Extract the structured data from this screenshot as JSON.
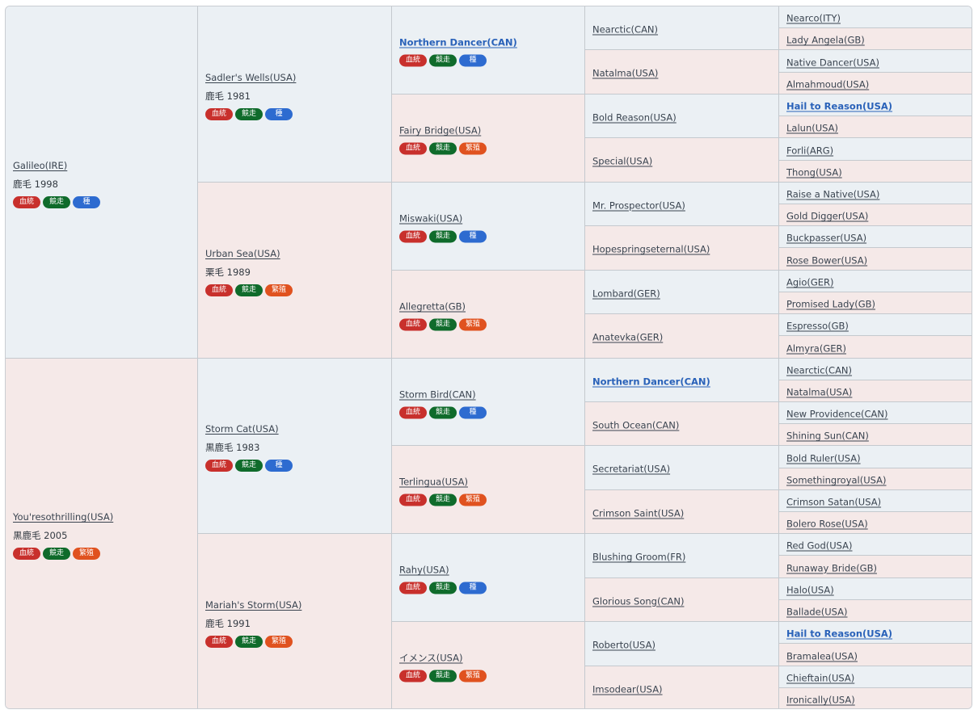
{
  "badge_labels": {
    "blood": "血統",
    "race": "競走",
    "sire": "種",
    "breed": "繁殖"
  },
  "colors": {
    "male_bg": "#ebf0f4",
    "female_bg": "#f5e9e8",
    "link_bold": "#2a62b9",
    "badge_blood": "#c8302c",
    "badge_race": "#0f6b2b",
    "badge_sire": "#2d6bd0",
    "badge_breed": "#e0521f"
  },
  "pedigree": {
    "gen1": [
      {
        "name": "Galileo(IRE)",
        "info": "鹿毛 1998",
        "badges": [
          "blood",
          "race",
          "sire"
        ]
      },
      {
        "name": "You'resothrilling(USA)",
        "info": "黒鹿毛 2005",
        "badges": [
          "blood",
          "race",
          "breed"
        ]
      }
    ],
    "gen2": [
      {
        "name": "Sadler's Wells(USA)",
        "info": "鹿毛 1981",
        "badges": [
          "blood",
          "race",
          "sire"
        ]
      },
      {
        "name": "Urban Sea(USA)",
        "info": "栗毛 1989",
        "badges": [
          "blood",
          "race",
          "breed"
        ]
      },
      {
        "name": "Storm Cat(USA)",
        "info": "黒鹿毛 1983",
        "badges": [
          "blood",
          "race",
          "sire"
        ]
      },
      {
        "name": "Mariah's Storm(USA)",
        "info": "鹿毛 1991",
        "badges": [
          "blood",
          "race",
          "breed"
        ]
      }
    ],
    "gen3": [
      {
        "name": "Northern Dancer(CAN)",
        "bold": true,
        "badges": [
          "blood",
          "race",
          "sire"
        ]
      },
      {
        "name": "Fairy Bridge(USA)",
        "badges": [
          "blood",
          "race",
          "breed"
        ]
      },
      {
        "name": "Miswaki(USA)",
        "badges": [
          "blood",
          "race",
          "sire"
        ]
      },
      {
        "name": "Allegretta(GB)",
        "badges": [
          "blood",
          "race",
          "breed"
        ]
      },
      {
        "name": "Storm Bird(CAN)",
        "badges": [
          "blood",
          "race",
          "sire"
        ]
      },
      {
        "name": "Terlingua(USA)",
        "badges": [
          "blood",
          "race",
          "breed"
        ]
      },
      {
        "name": "Rahy(USA)",
        "badges": [
          "blood",
          "race",
          "sire"
        ]
      },
      {
        "name": "イメンス(USA)",
        "badges": [
          "blood",
          "race",
          "breed"
        ]
      }
    ],
    "gen4": [
      {
        "name": "Nearctic(CAN)"
      },
      {
        "name": "Natalma(USA)"
      },
      {
        "name": "Bold Reason(USA)"
      },
      {
        "name": "Special(USA)"
      },
      {
        "name": "Mr. Prospector(USA)"
      },
      {
        "name": "Hopespringseternal(USA)"
      },
      {
        "name": "Lombard(GER)"
      },
      {
        "name": "Anatevka(GER)"
      },
      {
        "name": "Northern Dancer(CAN)",
        "bold": true
      },
      {
        "name": "South Ocean(CAN)"
      },
      {
        "name": "Secretariat(USA)"
      },
      {
        "name": "Crimson Saint(USA)"
      },
      {
        "name": "Blushing Groom(FR)"
      },
      {
        "name": "Glorious Song(CAN)"
      },
      {
        "name": "Roberto(USA)"
      },
      {
        "name": "Imsodear(USA)"
      }
    ],
    "gen5": [
      {
        "name": "Nearco(ITY)"
      },
      {
        "name": "Lady Angela(GB)"
      },
      {
        "name": "Native Dancer(USA)"
      },
      {
        "name": "Almahmoud(USA)"
      },
      {
        "name": "Hail to Reason(USA)",
        "bold": true
      },
      {
        "name": "Lalun(USA)"
      },
      {
        "name": "Forli(ARG)"
      },
      {
        "name": "Thong(USA)"
      },
      {
        "name": "Raise a Native(USA)"
      },
      {
        "name": "Gold Digger(USA)"
      },
      {
        "name": "Buckpasser(USA)"
      },
      {
        "name": "Rose Bower(USA)"
      },
      {
        "name": "Agio(GER)"
      },
      {
        "name": "Promised Lady(GB)"
      },
      {
        "name": "Espresso(GB)"
      },
      {
        "name": "Almyra(GER)"
      },
      {
        "name": "Nearctic(CAN)"
      },
      {
        "name": "Natalma(USA)"
      },
      {
        "name": "New Providence(CAN)"
      },
      {
        "name": "Shining Sun(CAN)"
      },
      {
        "name": "Bold Ruler(USA)"
      },
      {
        "name": "Somethingroyal(USA)"
      },
      {
        "name": "Crimson Satan(USA)"
      },
      {
        "name": "Bolero Rose(USA)"
      },
      {
        "name": "Red God(USA)"
      },
      {
        "name": "Runaway Bride(GB)"
      },
      {
        "name": "Halo(USA)"
      },
      {
        "name": "Ballade(USA)"
      },
      {
        "name": "Hail to Reason(USA)",
        "bold": true
      },
      {
        "name": "Bramalea(USA)"
      },
      {
        "name": "Chieftain(USA)"
      },
      {
        "name": "Ironically(USA)"
      }
    ]
  }
}
